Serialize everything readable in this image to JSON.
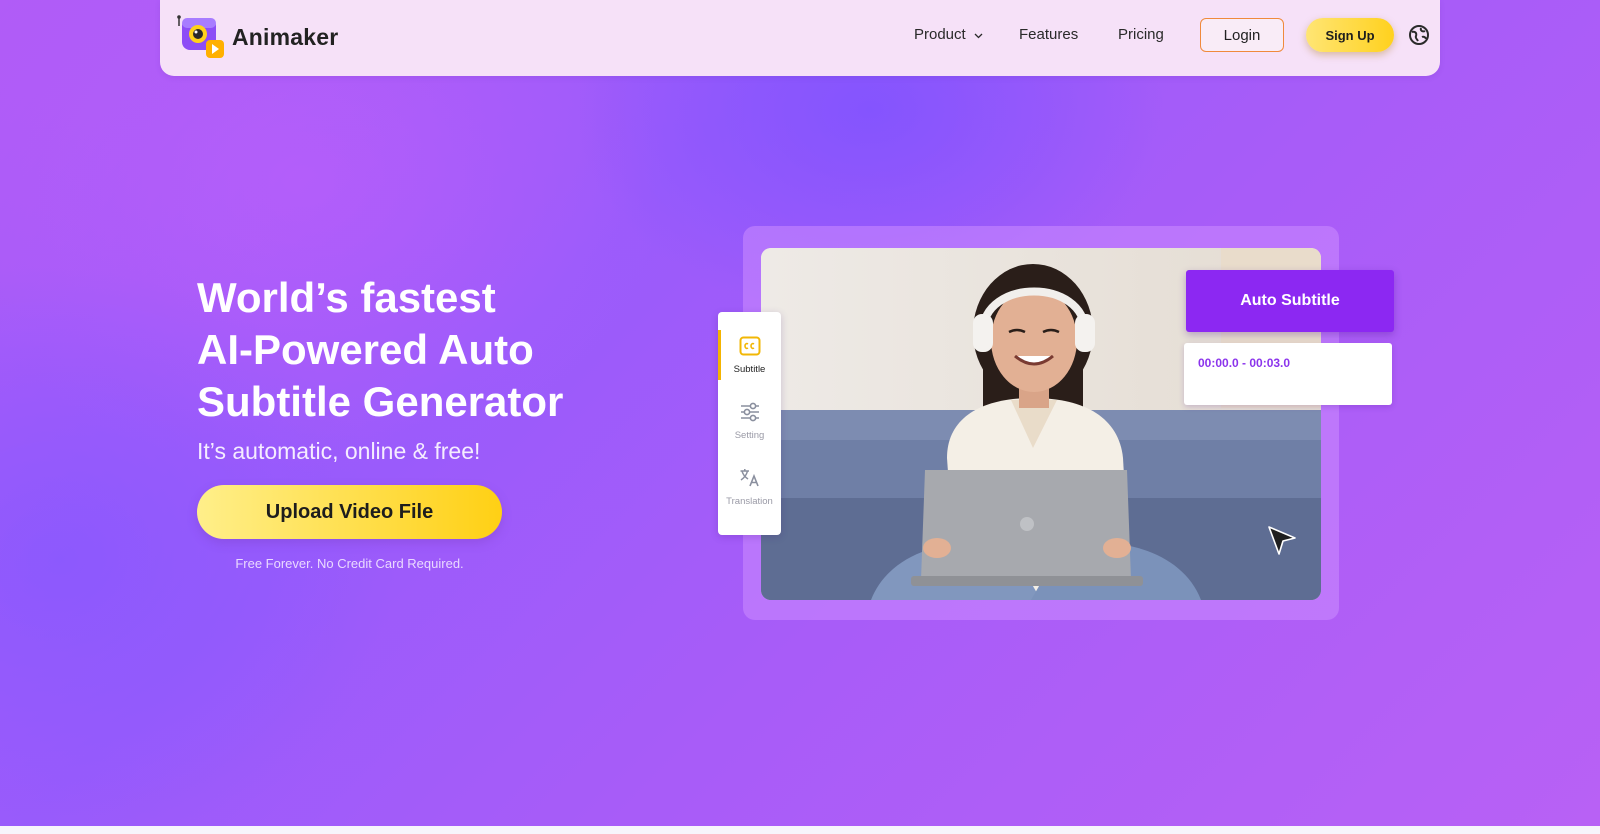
{
  "brand": {
    "name": "Animaker",
    "logo_icon": "animaker-camera-logo",
    "accent_purple": "#8c28f2",
    "accent_yellow": "#ffd11e"
  },
  "nav": {
    "items": [
      {
        "label": "Product",
        "has_dropdown": true
      },
      {
        "label": "Features"
      },
      {
        "label": "Pricing"
      }
    ],
    "login_label": "Login",
    "signup_label": "Sign Up",
    "language_icon": "globe-icon"
  },
  "hero": {
    "headline_lines": [
      "World’s fastest",
      "AI-Powered Auto",
      "Subtitle Generator"
    ],
    "subheadline": "It’s automatic, online & free!",
    "cta_label": "Upload Video File",
    "fine_print": "Free Forever. No Credit Card Required."
  },
  "editor_preview": {
    "side_tools": [
      {
        "label": "Subtitle",
        "icon": "closed-caption-icon",
        "active": true
      },
      {
        "label": "Setting",
        "icon": "sliders-icon",
        "active": false
      },
      {
        "label": "Translation",
        "icon": "translate-icon",
        "active": false
      }
    ],
    "auto_subtitle_label": "Auto Subtitle",
    "timestamp": "00:00.0 - 00:03.0",
    "cursor_icon": "mouse-pointer-icon"
  }
}
